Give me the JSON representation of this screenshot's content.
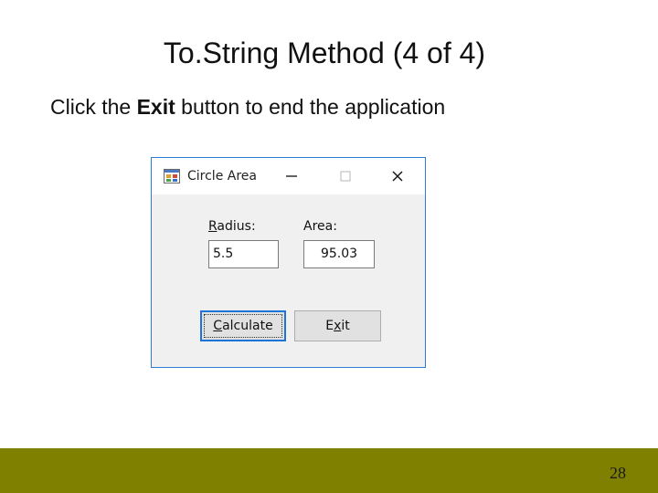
{
  "slide": {
    "title": "To.String Method (4 of 4)",
    "body_prefix": "Click the ",
    "body_bold": "Exit",
    "body_suffix": " button to end the application",
    "page_number": "28",
    "footer_color": "#7f7f00"
  },
  "window": {
    "title": "Circle Area",
    "icon": "form-icon",
    "controls": {
      "minimize": "minimize-icon",
      "maximize": "maximize-icon",
      "close": "close-icon"
    },
    "radius_label_mnemonic": "R",
    "radius_label_rest": "adius:",
    "area_label": "Area:",
    "radius_value": "5.5",
    "area_value": "95.03",
    "calculate_mnemonic": "C",
    "calculate_rest": "alculate",
    "exit_prefix": "E",
    "exit_mnemonic": "x",
    "exit_rest": "it",
    "accent_color": "#1e74d6"
  }
}
